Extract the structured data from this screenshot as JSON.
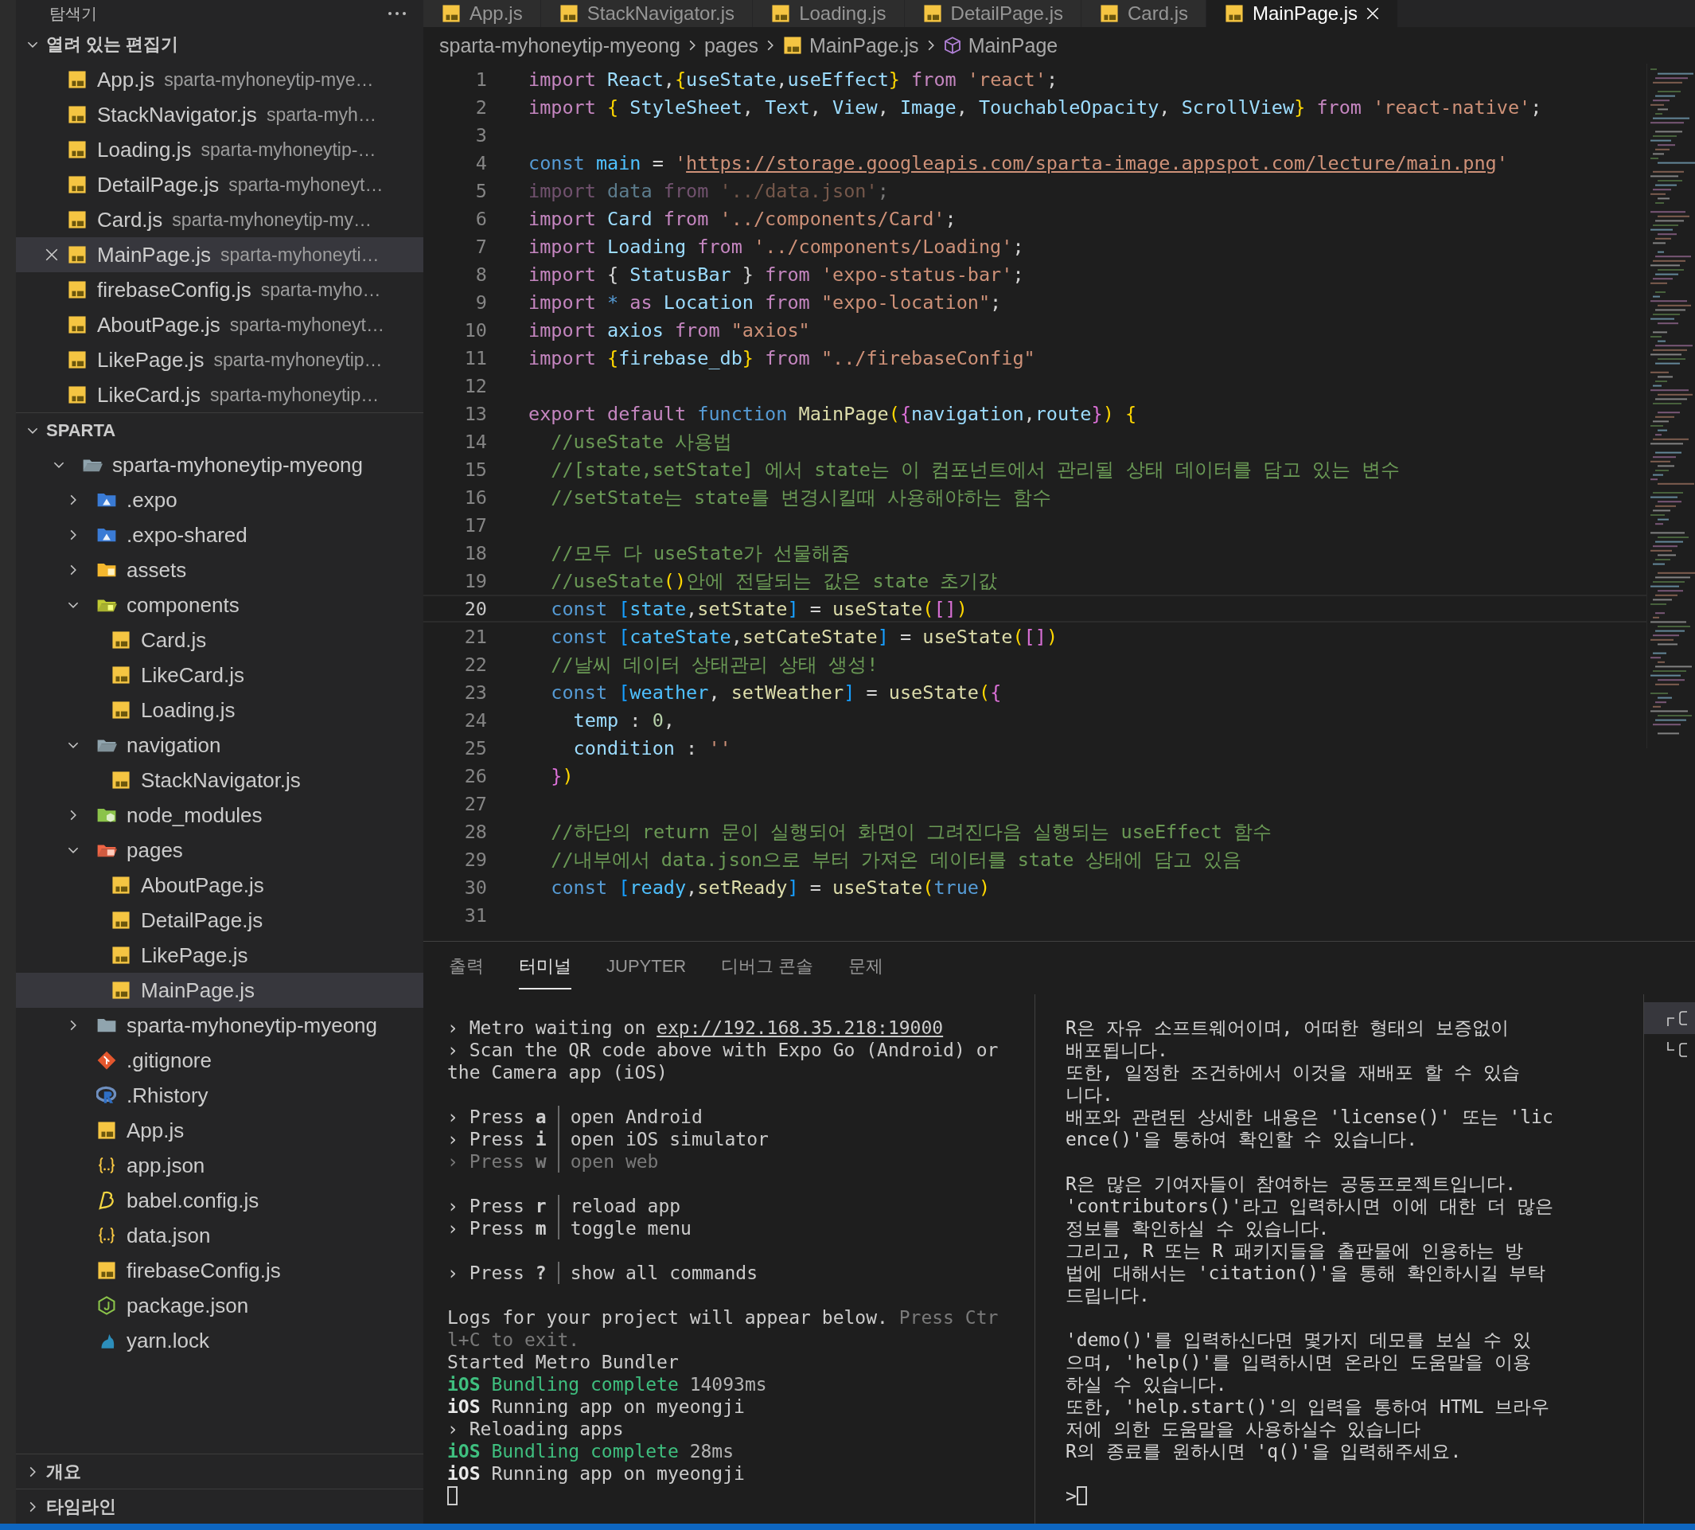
{
  "sidebar": {
    "title": "탐색기",
    "open_editors": {
      "title": "열려 있는 편집기",
      "expanded": true,
      "items": [
        {
          "name": "App.js",
          "path": "sparta-myhoneytip-mye…",
          "selected": false
        },
        {
          "name": "StackNavigator.js",
          "path": "sparta-myh…",
          "selected": false
        },
        {
          "name": "Loading.js",
          "path": "sparta-myhoneytip-…",
          "selected": false
        },
        {
          "name": "DetailPage.js",
          "path": "sparta-myhoneyt…",
          "selected": false
        },
        {
          "name": "Card.js",
          "path": "sparta-myhoneytip-my…",
          "selected": false
        },
        {
          "name": "MainPage.js",
          "path": "sparta-myhoneyti…",
          "selected": true
        },
        {
          "name": "firebaseConfig.js",
          "path": "sparta-myho…",
          "selected": false
        },
        {
          "name": "AboutPage.js",
          "path": "sparta-myhoneyt…",
          "selected": false
        },
        {
          "name": "LikePage.js",
          "path": "sparta-myhoneytip…",
          "selected": false
        },
        {
          "name": "LikeCard.js",
          "path": "sparta-myhoneytip…",
          "selected": false
        }
      ]
    },
    "workspace": {
      "title": "SPARTA",
      "expanded": true,
      "tree": [
        {
          "label": "sparta-myhoneytip-myeong",
          "kind": "folder",
          "expanded": true,
          "selected": false,
          "children": [
            {
              "label": ".expo",
              "kind": "folder-expo",
              "expanded": false,
              "selected": false
            },
            {
              "label": ".expo-shared",
              "kind": "folder-expo",
              "expanded": false,
              "selected": false
            },
            {
              "label": "assets",
              "kind": "folder-assets",
              "expanded": false,
              "selected": false
            },
            {
              "label": "components",
              "kind": "folder-components",
              "expanded": true,
              "selected": false,
              "children": [
                {
                  "label": "Card.js",
                  "kind": "js",
                  "selected": false
                },
                {
                  "label": "LikeCard.js",
                  "kind": "js",
                  "selected": false
                },
                {
                  "label": "Loading.js",
                  "kind": "js",
                  "selected": false
                }
              ]
            },
            {
              "label": "navigation",
              "kind": "folder",
              "expanded": true,
              "selected": false,
              "children": [
                {
                  "label": "StackNavigator.js",
                  "kind": "js",
                  "selected": false
                }
              ]
            },
            {
              "label": "node_modules",
              "kind": "folder-node",
              "expanded": false,
              "selected": false
            },
            {
              "label": "pages",
              "kind": "folder-pages",
              "expanded": true,
              "selected": false,
              "children": [
                {
                  "label": "AboutPage.js",
                  "kind": "js",
                  "selected": false
                },
                {
                  "label": "DetailPage.js",
                  "kind": "js",
                  "selected": false
                },
                {
                  "label": "LikePage.js",
                  "kind": "js",
                  "selected": false
                },
                {
                  "label": "MainPage.js",
                  "kind": "js",
                  "selected": true
                }
              ]
            },
            {
              "label": "sparta-myhoneytip-myeong",
              "kind": "folder",
              "expanded": false,
              "selected": false
            },
            {
              "label": ".gitignore",
              "kind": "git",
              "selected": false
            },
            {
              "label": ".Rhistory",
              "kind": "r",
              "selected": false
            },
            {
              "label": "App.js",
              "kind": "js",
              "selected": false
            },
            {
              "label": "app.json",
              "kind": "json",
              "selected": false
            },
            {
              "label": "babel.config.js",
              "kind": "babel",
              "selected": false
            },
            {
              "label": "data.json",
              "kind": "json",
              "selected": false
            },
            {
              "label": "firebaseConfig.js",
              "kind": "js",
              "selected": false
            },
            {
              "label": "package.json",
              "kind": "npm",
              "selected": false
            },
            {
              "label": "yarn.lock",
              "kind": "yarn",
              "selected": false
            }
          ]
        }
      ]
    },
    "sections": [
      {
        "title": "개요",
        "expanded": false
      },
      {
        "title": "타임라인",
        "expanded": false
      }
    ]
  },
  "editor": {
    "tabs": [
      {
        "label": "App.js",
        "selected": false
      },
      {
        "label": "StackNavigator.js",
        "selected": false
      },
      {
        "label": "Loading.js",
        "selected": false
      },
      {
        "label": "DetailPage.js",
        "selected": false
      },
      {
        "label": "Card.js",
        "selected": false
      },
      {
        "label": "MainPage.js",
        "selected": true
      }
    ],
    "breadcrumb": [
      {
        "label": "sparta-myhoneytip-myeong",
        "kind": "folder"
      },
      {
        "label": "pages",
        "kind": "folder"
      },
      {
        "label": "MainPage.js",
        "kind": "file"
      },
      {
        "label": "MainPage",
        "kind": "symbol"
      }
    ],
    "lines": [
      {
        "number": "1",
        "current": false,
        "unused": false,
        "tokens": [
          {
            "kind": "keyword",
            "text": "import "
          },
          {
            "kind": "variable",
            "text": "React"
          },
          {
            "kind": "punctuation",
            "text": ","
          },
          {
            "kind": "bracket1",
            "text": "{"
          },
          {
            "kind": "variable",
            "text": "useState"
          },
          {
            "kind": "punctuation",
            "text": ","
          },
          {
            "kind": "variable",
            "text": "useEffect"
          },
          {
            "kind": "bracket1",
            "text": "}"
          },
          {
            "kind": "keyword",
            "text": " from "
          },
          {
            "kind": "string",
            "text": "'react'"
          },
          {
            "kind": "punctuation",
            "text": ";"
          }
        ]
      },
      {
        "number": "2",
        "current": false,
        "unused": false,
        "tokens": [
          {
            "kind": "keyword",
            "text": "import "
          },
          {
            "kind": "bracket1",
            "text": "{"
          },
          {
            "kind": "variable",
            "text": " StyleSheet"
          },
          {
            "kind": "punctuation",
            "text": ", "
          },
          {
            "kind": "variable",
            "text": "Text"
          },
          {
            "kind": "punctuation",
            "text": ", "
          },
          {
            "kind": "variable",
            "text": "View"
          },
          {
            "kind": "punctuation",
            "text": ", "
          },
          {
            "kind": "variable",
            "text": "Image"
          },
          {
            "kind": "punctuation",
            "text": ", "
          },
          {
            "kind": "variable",
            "text": "TouchableOpacity"
          },
          {
            "kind": "punctuation",
            "text": ", "
          },
          {
            "kind": "variable",
            "text": "ScrollView"
          },
          {
            "kind": "bracket1",
            "text": "}"
          },
          {
            "kind": "keyword",
            "text": " from "
          },
          {
            "kind": "string",
            "text": "'react-native'"
          },
          {
            "kind": "punctuation",
            "text": ";"
          }
        ]
      },
      {
        "number": "3",
        "current": false
      },
      {
        "number": "4",
        "current": false,
        "unused": false,
        "tokens": [
          {
            "kind": "storage",
            "text": "const "
          },
          {
            "kind": "constant",
            "text": "main"
          },
          {
            "kind": "punctuation",
            "text": " = "
          },
          {
            "kind": "string",
            "text": "'"
          },
          {
            "kind": "link",
            "text": "https://storage.googleapis.com/sparta-image.appspot.com/lecture/main.png"
          },
          {
            "kind": "string",
            "text": "'"
          }
        ]
      },
      {
        "number": "5",
        "current": false,
        "unused": true,
        "tokens": [
          {
            "kind": "keyword",
            "text": "import "
          },
          {
            "kind": "variable",
            "text": "data "
          },
          {
            "kind": "keyword",
            "text": "from "
          },
          {
            "kind": "string",
            "text": "'../data.json'"
          },
          {
            "kind": "punctuation",
            "text": ";"
          }
        ]
      },
      {
        "number": "6",
        "current": false,
        "unused": false,
        "tokens": [
          {
            "kind": "keyword",
            "text": "import "
          },
          {
            "kind": "variable",
            "text": "Card"
          },
          {
            "kind": "keyword",
            "text": " from "
          },
          {
            "kind": "string",
            "text": "'../components/Card'"
          },
          {
            "kind": "punctuation",
            "text": ";"
          }
        ]
      },
      {
        "number": "7",
        "current": false,
        "unused": false,
        "tokens": [
          {
            "kind": "keyword",
            "text": "import "
          },
          {
            "kind": "variable",
            "text": "Loading"
          },
          {
            "kind": "keyword",
            "text": " from "
          },
          {
            "kind": "string",
            "text": "'../components/Loading'"
          },
          {
            "kind": "punctuation",
            "text": ";"
          }
        ]
      },
      {
        "number": "8",
        "current": false,
        "unused": false,
        "tokens": [
          {
            "kind": "keyword",
            "text": "import "
          },
          {
            "kind": "punctuation",
            "text": "{ "
          },
          {
            "kind": "variable",
            "text": "StatusBar"
          },
          {
            "kind": "punctuation",
            "text": " } "
          },
          {
            "kind": "keyword",
            "text": "from "
          },
          {
            "kind": "string",
            "text": "'expo-status-bar'"
          },
          {
            "kind": "punctuation",
            "text": ";"
          }
        ]
      },
      {
        "number": "9",
        "current": false,
        "unused": false,
        "tokens": [
          {
            "kind": "keyword",
            "text": "import "
          },
          {
            "kind": "storage",
            "text": "* "
          },
          {
            "kind": "keyword",
            "text": "as "
          },
          {
            "kind": "variable",
            "text": "Location"
          },
          {
            "kind": "keyword",
            "text": " from "
          },
          {
            "kind": "string",
            "text": "\"expo-location\""
          },
          {
            "kind": "punctuation",
            "text": ";"
          }
        ]
      },
      {
        "number": "10",
        "current": false,
        "unused": false,
        "tokens": [
          {
            "kind": "keyword",
            "text": "import "
          },
          {
            "kind": "variable",
            "text": "axios"
          },
          {
            "kind": "keyword",
            "text": " from "
          },
          {
            "kind": "string",
            "text": "\"axios\""
          }
        ]
      },
      {
        "number": "11",
        "current": false,
        "unused": false,
        "tokens": [
          {
            "kind": "keyword",
            "text": "import "
          },
          {
            "kind": "bracket1",
            "text": "{"
          },
          {
            "kind": "variable",
            "text": "firebase_db"
          },
          {
            "kind": "bracket1",
            "text": "}"
          },
          {
            "kind": "keyword",
            "text": " from "
          },
          {
            "kind": "string",
            "text": "\"../firebaseConfig\""
          }
        ]
      },
      {
        "number": "12",
        "current": false
      },
      {
        "number": "13",
        "current": false,
        "unused": false,
        "tokens": [
          {
            "kind": "keyword",
            "text": "export default "
          },
          {
            "kind": "storage",
            "text": "function "
          },
          {
            "kind": "function",
            "text": "MainPage"
          },
          {
            "kind": "bracket1",
            "text": "("
          },
          {
            "kind": "bracket2",
            "text": "{"
          },
          {
            "kind": "variable",
            "text": "navigation"
          },
          {
            "kind": "punctuation",
            "text": ","
          },
          {
            "kind": "variable",
            "text": "route"
          },
          {
            "kind": "bracket2",
            "text": "}"
          },
          {
            "kind": "bracket1",
            "text": ")"
          },
          {
            "kind": "bracket1",
            "text": " {"
          }
        ]
      },
      {
        "number": "14",
        "current": false,
        "unused": false,
        "tokens": [
          {
            "kind": "comment",
            "text": "  //useState 사용법"
          }
        ]
      },
      {
        "number": "15",
        "current": false,
        "unused": false,
        "tokens": [
          {
            "kind": "comment",
            "text": "  //[state,setState] 에서 state는 이 컴포넌트에서 관리될 상태 데이터를 담고 있는 변수"
          }
        ]
      },
      {
        "number": "16",
        "current": false,
        "unused": false,
        "tokens": [
          {
            "kind": "comment",
            "text": "  //setState는 state를 변경시킬때 사용해야하는 함수"
          }
        ]
      },
      {
        "number": "17",
        "current": false
      },
      {
        "number": "18",
        "current": false,
        "unused": false,
        "tokens": [
          {
            "kind": "comment",
            "text": "  //모두 다 useState가 선물해줌"
          }
        ]
      },
      {
        "number": "19",
        "current": false,
        "unused": false,
        "tokens": [
          {
            "kind": "comment",
            "text": "  //useState"
          },
          {
            "kind": "bracket1",
            "text": "()"
          },
          {
            "kind": "comment",
            "text": "안에 전달되는 값은 state 초기값"
          }
        ]
      },
      {
        "number": "20",
        "current": true,
        "unused": false,
        "tokens": [
          {
            "kind": "storage",
            "text": "  const "
          },
          {
            "kind": "bracket3",
            "text": "["
          },
          {
            "kind": "constant",
            "text": "state"
          },
          {
            "kind": "punctuation",
            "text": ","
          },
          {
            "kind": "function",
            "text": "setState"
          },
          {
            "kind": "bracket3",
            "text": "]"
          },
          {
            "kind": "punctuation",
            "text": " = "
          },
          {
            "kind": "function",
            "text": "useState"
          },
          {
            "kind": "bracket1",
            "text": "("
          },
          {
            "kind": "bracket2",
            "text": "[]"
          },
          {
            "kind": "bracket1",
            "text": ")"
          }
        ]
      },
      {
        "number": "21",
        "current": false,
        "unused": false,
        "tokens": [
          {
            "kind": "storage",
            "text": "  const "
          },
          {
            "kind": "bracket3",
            "text": "["
          },
          {
            "kind": "constant",
            "text": "cateState"
          },
          {
            "kind": "punctuation",
            "text": ","
          },
          {
            "kind": "function",
            "text": "setCateState"
          },
          {
            "kind": "bracket3",
            "text": "]"
          },
          {
            "kind": "punctuation",
            "text": " = "
          },
          {
            "kind": "function",
            "text": "useState"
          },
          {
            "kind": "bracket1",
            "text": "("
          },
          {
            "kind": "bracket2",
            "text": "[]"
          },
          {
            "kind": "bracket1",
            "text": ")"
          }
        ]
      },
      {
        "number": "22",
        "current": false,
        "unused": false,
        "tokens": [
          {
            "kind": "comment",
            "text": "  //날씨 데이터 상태관리 상태 생성!"
          }
        ]
      },
      {
        "number": "23",
        "current": false,
        "unused": false,
        "tokens": [
          {
            "kind": "storage",
            "text": "  const "
          },
          {
            "kind": "bracket3",
            "text": "["
          },
          {
            "kind": "constant",
            "text": "weather"
          },
          {
            "kind": "punctuation",
            "text": ", "
          },
          {
            "kind": "function",
            "text": "setWeather"
          },
          {
            "kind": "bracket3",
            "text": "]"
          },
          {
            "kind": "punctuation",
            "text": " = "
          },
          {
            "kind": "function",
            "text": "useState"
          },
          {
            "kind": "bracket1",
            "text": "("
          },
          {
            "kind": "bracket2",
            "text": "{"
          }
        ]
      },
      {
        "number": "24",
        "current": false,
        "unused": false,
        "tokens": [
          {
            "kind": "variable",
            "text": "    temp"
          },
          {
            "kind": "punctuation",
            "text": " : "
          },
          {
            "kind": "number",
            "text": "0"
          },
          {
            "kind": "punctuation",
            "text": ","
          }
        ]
      },
      {
        "number": "25",
        "current": false,
        "unused": false,
        "tokens": [
          {
            "kind": "variable",
            "text": "    condition"
          },
          {
            "kind": "punctuation",
            "text": " : "
          },
          {
            "kind": "string",
            "text": "''"
          }
        ]
      },
      {
        "number": "26",
        "current": false,
        "unused": false,
        "tokens": [
          {
            "kind": "bracket2",
            "text": "  }"
          },
          {
            "kind": "bracket1",
            "text": ")"
          }
        ]
      },
      {
        "number": "27",
        "current": false
      },
      {
        "number": "28",
        "current": false,
        "unused": false,
        "tokens": [
          {
            "kind": "comment",
            "text": "  //하단의 return 문이 실행되어 화면이 그려진다음 실행되는 useEffect 함수"
          }
        ]
      },
      {
        "number": "29",
        "current": false,
        "unused": false,
        "tokens": [
          {
            "kind": "comment",
            "text": "  //내부에서 data.json으로 부터 가져온 데이터를 state 상태에 담고 있음"
          }
        ]
      },
      {
        "number": "30",
        "current": false,
        "unused": false,
        "tokens": [
          {
            "kind": "storage",
            "text": "  const "
          },
          {
            "kind": "bracket3",
            "text": "["
          },
          {
            "kind": "constant",
            "text": "ready"
          },
          {
            "kind": "punctuation",
            "text": ","
          },
          {
            "kind": "function",
            "text": "setReady"
          },
          {
            "kind": "bracket3",
            "text": "]"
          },
          {
            "kind": "punctuation",
            "text": " = "
          },
          {
            "kind": "function",
            "text": "useState"
          },
          {
            "kind": "bracket1",
            "text": "("
          },
          {
            "kind": "storage",
            "text": "true"
          },
          {
            "kind": "bracket1",
            "text": ")"
          }
        ]
      },
      {
        "number": "31",
        "current": false
      }
    ]
  },
  "panel": {
    "tabs": [
      {
        "label": "출력",
        "selected": false
      },
      {
        "label": "터미널",
        "selected": true
      },
      {
        "label": "JUPYTER",
        "selected": false
      },
      {
        "label": "디버그 콘솔",
        "selected": false
      },
      {
        "label": "문제",
        "selected": false
      }
    ],
    "terminal": {
      "lines": [
        {
          "kind": "text",
          "segments": [
            {
              "kind": "plain",
              "text": "› Metro waiting on "
            },
            {
              "kind": "link",
              "text": "exp://192.168.35.218:19000"
            }
          ]
        },
        {
          "kind": "text",
          "segments": [
            {
              "kind": "plain",
              "text": "› Scan the QR code above with Expo Go (Android) or"
            }
          ]
        },
        {
          "kind": "text",
          "segments": [
            {
              "kind": "plain",
              "text": "the Camera app (iOS)"
            }
          ]
        },
        {
          "kind": "blank"
        },
        {
          "kind": "press",
          "prompt": "›",
          "label": "Press",
          "key": "a",
          "action": "open Android",
          "dim": false
        },
        {
          "kind": "press",
          "prompt": "›",
          "label": "Press",
          "key": "i",
          "action": "open iOS simulator",
          "dim": false
        },
        {
          "kind": "press",
          "prompt": "›",
          "label": "Press",
          "key": "w",
          "action": "open web",
          "dim": true
        },
        {
          "kind": "blank"
        },
        {
          "kind": "press",
          "prompt": "›",
          "label": "Press",
          "key": "r",
          "action": "reload app",
          "dim": false
        },
        {
          "kind": "press",
          "prompt": "›",
          "label": "Press",
          "key": "m",
          "action": "toggle menu",
          "dim": false
        },
        {
          "kind": "blank"
        },
        {
          "kind": "press",
          "prompt": "›",
          "label": "Press",
          "key": "?",
          "action": "show all commands",
          "dim": false
        },
        {
          "kind": "blank"
        },
        {
          "kind": "text",
          "segments": [
            {
              "kind": "plain",
              "text": "Logs for your project will appear below. "
            },
            {
              "kind": "faint",
              "text": "Press Ctr"
            }
          ]
        },
        {
          "kind": "text",
          "segments": [
            {
              "kind": "faint",
              "text": "l+C to exit."
            }
          ]
        },
        {
          "kind": "text",
          "segments": [
            {
              "kind": "plain",
              "text": "Started Metro Bundler"
            }
          ]
        },
        {
          "kind": "text",
          "segments": [
            {
              "kind": "success_strong",
              "text": "iOS"
            },
            {
              "kind": "success",
              "text": " Bundling complete"
            },
            {
              "kind": "timing",
              "text": " 14093ms"
            }
          ]
        },
        {
          "kind": "text",
          "segments": [
            {
              "kind": "strong",
              "text": "iOS"
            },
            {
              "kind": "plain",
              "text": " Running app on myeongji"
            }
          ]
        },
        {
          "kind": "text",
          "segments": [
            {
              "kind": "plain",
              "text": "› Reloading apps"
            }
          ]
        },
        {
          "kind": "text",
          "segments": [
            {
              "kind": "success_strong",
              "text": "iOS"
            },
            {
              "kind": "success",
              "text": " Bundling complete"
            },
            {
              "kind": "timing",
              "text": " 28ms"
            }
          ]
        },
        {
          "kind": "text",
          "segments": [
            {
              "kind": "strong",
              "text": "iOS"
            },
            {
              "kind": "plain",
              "text": " Running app on myeongji"
            }
          ]
        },
        {
          "kind": "cursor"
        }
      ]
    },
    "r_console": {
      "lines": [
        {
          "kind": "text",
          "text": "R은 자유 소프트웨어이며, 어떠한 형태의 보증없이"
        },
        {
          "kind": "text",
          "text": "배포됩니다."
        },
        {
          "kind": "text",
          "text": "또한, 일정한 조건하에서 이것을 재배포 할 수 있습"
        },
        {
          "kind": "text",
          "text": "니다."
        },
        {
          "kind": "text",
          "text": "배포와 관련된 상세한 내용은 'license()' 또는 'lic"
        },
        {
          "kind": "text",
          "text": "ence()'을 통하여 확인할 수 있습니다."
        },
        {
          "kind": "blank"
        },
        {
          "kind": "text",
          "text": "R은 많은 기여자들이 참여하는 공동프로젝트입니다."
        },
        {
          "kind": "text",
          "text": "'contributors()'라고 입력하시면 이에 대한 더 많은"
        },
        {
          "kind": "text",
          "text": "정보를 확인하실 수 있습니다."
        },
        {
          "kind": "text",
          "text": "그리고, R 또는 R 패키지들을 출판물에 인용하는 방"
        },
        {
          "kind": "text",
          "text": "법에 대해서는 'citation()'을 통해 확인하시길 부탁"
        },
        {
          "kind": "text",
          "text": "드립니다."
        },
        {
          "kind": "blank"
        },
        {
          "kind": "text",
          "text": "'demo()'를 입력하신다면 몇가지 데모를 보실 수 있"
        },
        {
          "kind": "text",
          "text": "으며, 'help()'를 입력하시면 온라인 도움말을 이용"
        },
        {
          "kind": "text",
          "text": "하실 수 있습니다."
        },
        {
          "kind": "text",
          "text": "또한, 'help.start()'의 입력을 통하여 HTML 브라우"
        },
        {
          "kind": "text",
          "text": "저에 의한 도움말을 사용하실수 있습니다"
        },
        {
          "kind": "text",
          "text": "R의 종료를 원하시면 'q()'을 입력해주세요."
        },
        {
          "kind": "blank"
        },
        {
          "kind": "prompt",
          "text": ">"
        }
      ]
    }
  }
}
